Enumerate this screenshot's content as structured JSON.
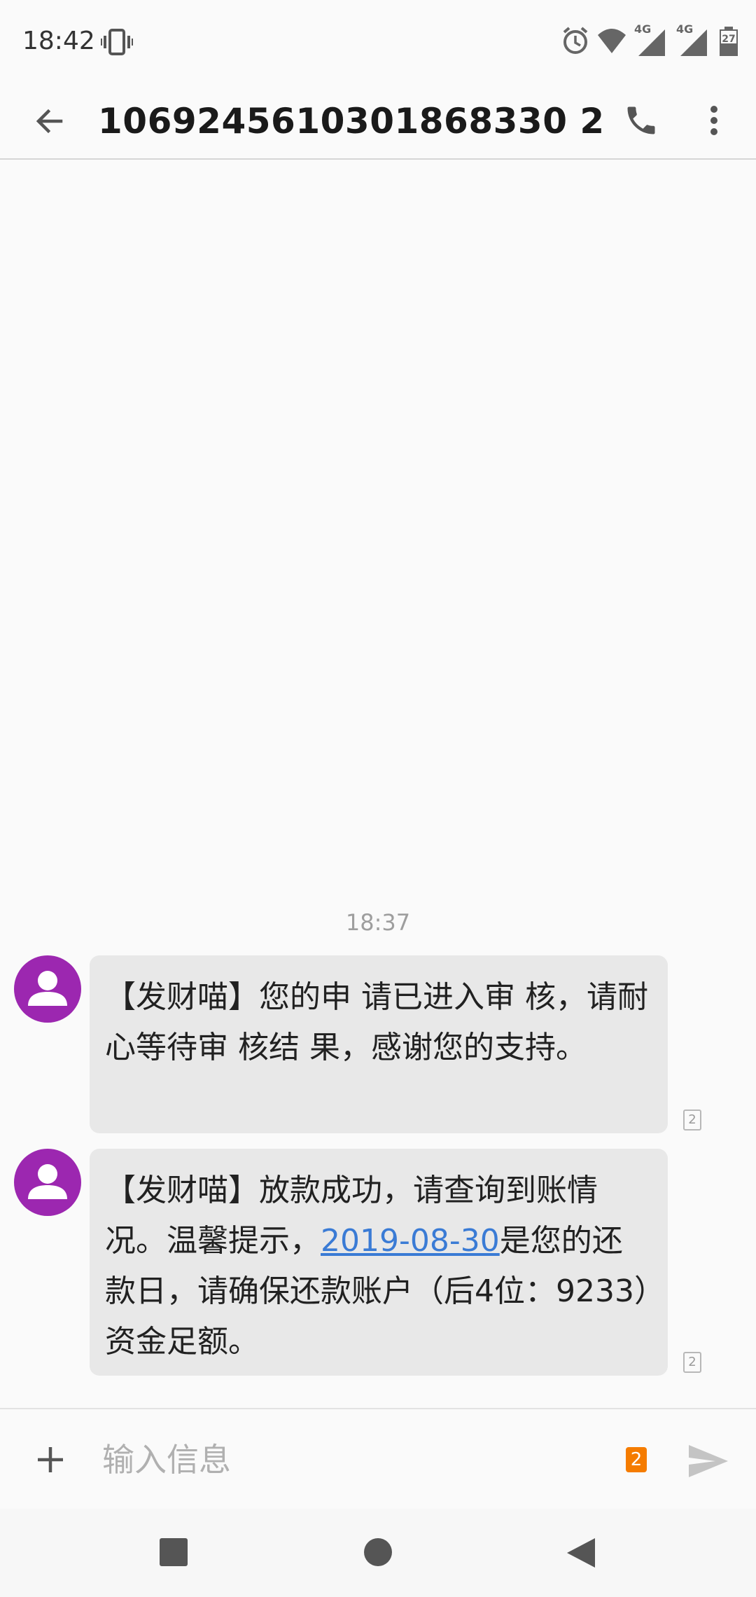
{
  "status_bar": {
    "time": "18:42",
    "network_1": "4G",
    "network_2": "4G",
    "battery": "27"
  },
  "app_bar": {
    "title": "1069245610301868330 2"
  },
  "conversation": {
    "timestamp": "18:37",
    "messages": [
      {
        "text": "【发财喵】您的申 请已进入审 核，请耐心等待审 核结 果，感谢您的支持。",
        "sim": "2"
      },
      {
        "text_before_link": "【发财喵】放款成功，请查询到账情况。温馨提示，",
        "link": "2019-08-30",
        "text_after_link": "是您的还款日，请确保还款账户（后4位：9233）资金足额。",
        "sim": "2"
      }
    ]
  },
  "compose": {
    "placeholder": "输入信息",
    "sim": "2"
  },
  "colors": {
    "avatar": "#9c27b0",
    "bubble": "#e8e8e8",
    "link": "#3a7bd5",
    "sim_badge": "#f57c00"
  },
  "icons": [
    "vibrate-icon",
    "alarm-icon",
    "wifi-icon",
    "signal-icon",
    "battery-icon",
    "back-arrow-icon",
    "phone-icon",
    "more-vert-icon",
    "person-icon",
    "plus-icon",
    "send-icon"
  ]
}
